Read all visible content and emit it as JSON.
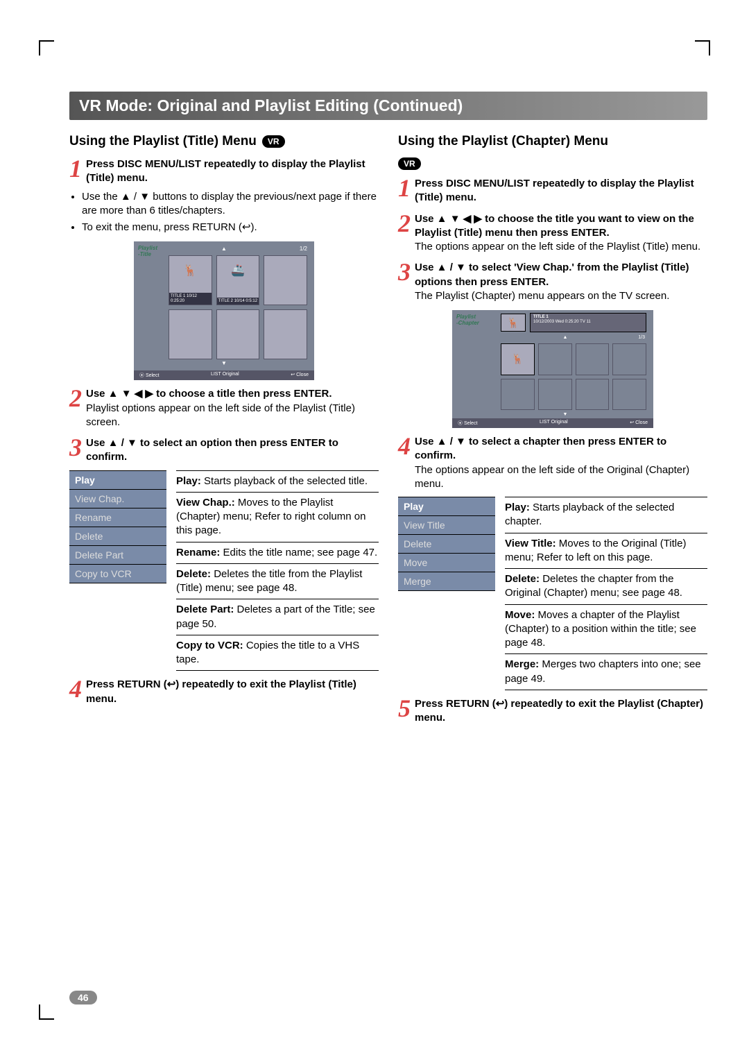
{
  "banner": "VR Mode: Original and Playlist Editing (Continued)",
  "vr_badge": "VR",
  "page_number": "46",
  "left": {
    "title": "Using the Playlist (Title) Menu",
    "step1": {
      "bold": "Press DISC MENU/LIST repeatedly to display the Playlist (Title) menu.",
      "bullets": [
        "Use the ▲ / ▼ buttons to display the previous/next page if there are more than 6 titles/chapters.",
        "To exit the menu, press RETURN (↩)."
      ]
    },
    "osd": {
      "label1": "Playlist",
      "label2": "-Title",
      "pager": "1/2",
      "title1_caption": "TITLE 1\n10/12   0:25:20",
      "title2_caption": "TITLE 2\n10/14   0:5:12",
      "footer_select": "⦿ Select",
      "footer_original": "LIST Original",
      "footer_close": "↩ Close"
    },
    "step2": {
      "bold": "Use ▲ ▼ ◀ ▶ to choose a title then press ENTER.",
      "body": "Playlist options appear on the left side of the Playlist (Title) screen."
    },
    "step3": {
      "bold": "Use ▲ / ▼ to select an option then press ENTER to confirm."
    },
    "menu": [
      "Play",
      "View Chap.",
      "Rename",
      "Delete",
      "Delete Part",
      "Copy to VCR"
    ],
    "defs": [
      {
        "t": "Play:",
        "b": " Starts playback of the selected title."
      },
      {
        "t": "View Chap.:",
        "b": " Moves to the Playlist (Chapter) menu; Refer to right column on this page."
      },
      {
        "t": "Rename:",
        "b": " Edits the title name; see page 47."
      },
      {
        "t": "Delete:",
        "b": " Deletes the title from the Playlist (Title) menu; see page 48."
      },
      {
        "t": "Delete Part:",
        "b": " Deletes a part of the Title; see page 50."
      },
      {
        "t": "Copy to VCR:",
        "b": " Copies the title to a VHS tape."
      }
    ],
    "step4": {
      "bold": "Press RETURN (↩) repeatedly to exit the Playlist (Title) menu."
    }
  },
  "right": {
    "title": "Using the Playlist (Chapter) Menu",
    "step1": {
      "bold": "Press DISC MENU/LIST repeatedly to display the Playlist (Title) menu."
    },
    "step2": {
      "bold": "Use ▲ ▼ ◀ ▶ to choose the title you want to view on the Playlist (Title) menu then press ENTER.",
      "body": "The options appear on the left side of the Playlist (Title) menu."
    },
    "step3": {
      "bold": "Use ▲ / ▼ to select 'View Chap.' from the Playlist (Title) options then press ENTER.",
      "body": "The Playlist (Chapter) menu appears on the TV screen."
    },
    "osd": {
      "label1": "Playlist",
      "label2": "-Chapter",
      "meta_title": "TITLE 1",
      "meta_line": "10/12/2003  Wed  0:25:20  TV 11",
      "pager": "1/3",
      "footer_select": "⦿ Select",
      "footer_original": "LIST Original",
      "footer_close": "↩ Close"
    },
    "step4": {
      "bold": "Use ▲ / ▼ to select a chapter then press ENTER to confirm.",
      "body": "The options appear on the left side of the Original (Chapter) menu."
    },
    "menu": [
      "Play",
      "View Title",
      "Delete",
      "Move",
      "Merge"
    ],
    "defs": [
      {
        "t": "Play:",
        "b": " Starts playback of the selected chapter."
      },
      {
        "t": "View Title:",
        "b": " Moves to the Original (Title) menu; Refer to left on this page."
      },
      {
        "t": "Delete:",
        "b": " Deletes the chapter from the Original (Chapter) menu; see page 48."
      },
      {
        "t": "Move:",
        "b": " Moves a chapter of the Playlist (Chapter) to a position within the title; see page 48."
      },
      {
        "t": "Merge:",
        "b": " Merges two chapters into one; see page 49."
      }
    ],
    "step5": {
      "bold": "Press RETURN (↩) repeatedly to exit the Playlist (Chapter) menu."
    }
  }
}
